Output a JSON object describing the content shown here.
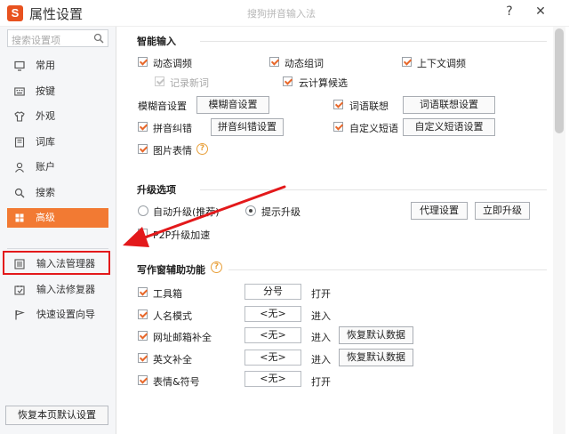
{
  "window": {
    "title": "属性设置",
    "subtitle": "搜狗拼音输入法",
    "help_label": "?",
    "close_label": "✕",
    "logo_text": "S",
    "accent_color": "#f27a33"
  },
  "sidebar": {
    "search_placeholder": "搜索设置项",
    "items": [
      {
        "label": "常用",
        "icon": "monitor-icon"
      },
      {
        "label": "按键",
        "icon": "keyboard-icon"
      },
      {
        "label": "外观",
        "icon": "shirt-icon"
      },
      {
        "label": "词库",
        "icon": "book-icon"
      },
      {
        "label": "账户",
        "icon": "user-icon"
      },
      {
        "label": "搜索",
        "icon": "search-icon"
      },
      {
        "label": "高级",
        "icon": "settings-icon",
        "active": true
      }
    ],
    "tools": [
      {
        "label": "输入法管理器",
        "icon": "list-icon"
      },
      {
        "label": "输入法修复器",
        "icon": "repair-icon"
      },
      {
        "label": "快速设置向导",
        "icon": "flag-icon"
      }
    ],
    "reset_label": "恢复本页默认设置"
  },
  "smart_input": {
    "title": "智能输入",
    "dynamic_freq": "动态调频",
    "dynamic_words": "动态组词",
    "context_freq": "上下文调频",
    "record_new": "记录新词",
    "cloud_candidates": "云计算候选",
    "fuzzy_label": "模糊音设置",
    "fuzzy_btn": "模糊音设置",
    "association": "词语联想",
    "association_btn": "词语联想设置",
    "correction": "拼音纠错",
    "correction_btn": "拼音纠错设置",
    "custom_phrase": "自定义短语",
    "custom_phrase_btn": "自定义短语设置",
    "emoji": "图片表情",
    "help": "?"
  },
  "upgrade": {
    "title": "升级选项",
    "auto": "自动升级(推荐)",
    "notify": "提示升级",
    "proxy_btn": "代理设置",
    "upgrade_now_btn": "立即升级",
    "p2p": "P2P升级加速"
  },
  "writing": {
    "title": "写作窗辅助功能",
    "help": "?",
    "restore_label": "恢复默认数据",
    "rows": [
      {
        "label": "工具箱",
        "key": "分号",
        "action": "打开",
        "restore": false
      },
      {
        "label": "人名模式",
        "key": "<无>",
        "action": "进入",
        "restore": false
      },
      {
        "label": "网址邮箱补全",
        "key": "<无>",
        "action": "进入",
        "restore": true
      },
      {
        "label": "英文补全",
        "key": "<无>",
        "action": "进入",
        "restore": true
      },
      {
        "label": "表情&符号",
        "key": "<无>",
        "action": "打开",
        "restore": false
      }
    ]
  }
}
